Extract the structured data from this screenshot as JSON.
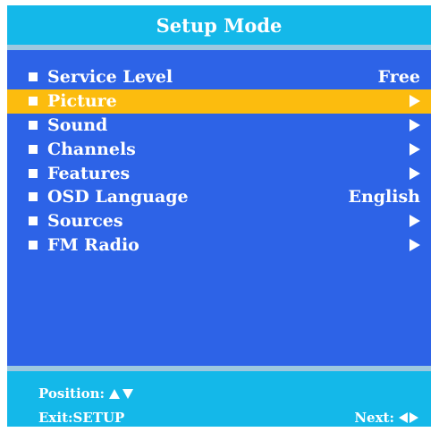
{
  "title": "Setup Mode",
  "menu": {
    "items": [
      {
        "label": "Service Level",
        "value": "Free",
        "has_arrow": false,
        "selected": false
      },
      {
        "label": "Picture",
        "value": "",
        "has_arrow": true,
        "selected": true
      },
      {
        "label": "Sound",
        "value": "",
        "has_arrow": true,
        "selected": false
      },
      {
        "label": "Channels",
        "value": "",
        "has_arrow": true,
        "selected": false
      },
      {
        "label": "Features",
        "value": "",
        "has_arrow": true,
        "selected": false
      },
      {
        "label": "OSD Language",
        "value": "English",
        "has_arrow": false,
        "selected": false
      },
      {
        "label": "Sources",
        "value": "",
        "has_arrow": true,
        "selected": false
      },
      {
        "label": "FM Radio",
        "value": "",
        "has_arrow": true,
        "selected": false
      }
    ]
  },
  "footer": {
    "position_label": "Position:",
    "position_icon": "up-down-arrows-icon",
    "exit_label": "Exit:SETUP",
    "next_label": "Next:",
    "next_icon": "left-right-arrows-icon"
  },
  "colors": {
    "title_bar": "#14b8e9",
    "menu_background": "#2d63e7",
    "selected_highlight": "#fcbc0e",
    "separator": "#9ec8df",
    "text": "#ffffff"
  }
}
